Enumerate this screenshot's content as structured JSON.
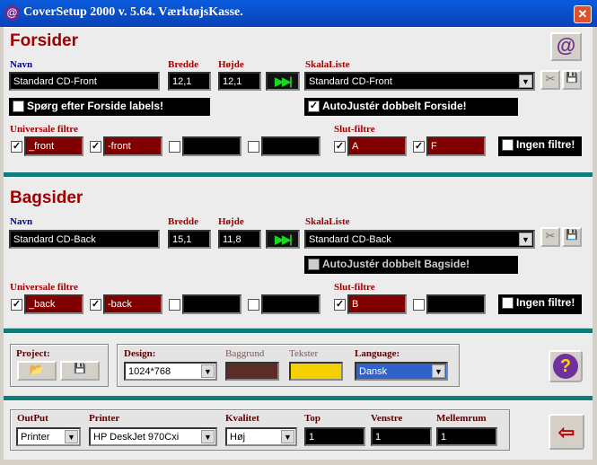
{
  "window": {
    "title": "CoverSetup 2000 v. 5.64. VærktøjsKasse.",
    "close_glyph": "✕",
    "app_glyph": "@"
  },
  "forsider": {
    "title": "Forsider",
    "navn_label": "Navn",
    "navn_value": "Standard CD-Front",
    "bredde_label": "Bredde",
    "bredde_value": "12,1",
    "hojde_label": "Højde",
    "hojde_value": "12,1",
    "skala_label": "SkalaListe",
    "skala_value": "Standard CD-Front",
    "spoerg_label": "Spørg efter Forside labels!",
    "autojuster_label": "AutoJustér dobbelt Forside!",
    "universale_label": "Universale filtre",
    "filters": [
      "_front",
      "-front",
      "",
      ""
    ],
    "filters_checked": [
      true,
      true,
      false,
      false
    ],
    "slut_label": "Slut-filtre",
    "slut_filters": [
      "A",
      "F"
    ],
    "slut_checked": [
      true,
      true
    ],
    "ingen_label": "Ingen filtre!"
  },
  "bagsider": {
    "title": "Bagsider",
    "navn_label": "Navn",
    "navn_value": "Standard CD-Back",
    "bredde_label": "Bredde",
    "bredde_value": "15,1",
    "hojde_label": "Højde",
    "hojde_value": "11,8",
    "skala_label": "SkalaListe",
    "skala_value": "Standard CD-Back",
    "autojuster_label": "AutoJustér dobbelt Bagside!",
    "universale_label": "Universale filtre",
    "filters": [
      "_back",
      "-back",
      "",
      ""
    ],
    "filters_checked": [
      true,
      true,
      false,
      false
    ],
    "slut_label": "Slut-filtre",
    "slut_filters": [
      "B",
      ""
    ],
    "slut_checked": [
      true,
      false
    ],
    "ingen_label": "Ingen filtre!"
  },
  "project": {
    "label": "Project:",
    "design_label": "Design:",
    "design_value": "1024*768",
    "baggrund_label": "Baggrund",
    "baggrund_color": "#5a2e24",
    "tekster_label": "Tekster",
    "tekster_color": "#f5d000",
    "language_label": "Language:",
    "language_value": "Dansk"
  },
  "output": {
    "output_label": "OutPut",
    "output_value": "Printer",
    "printer_label": "Printer",
    "printer_value": "HP DeskJet 970Cxi",
    "kvalitet_label": "Kvalitet",
    "kvalitet_value": "Høj",
    "top_label": "Top",
    "top_value": "1",
    "venstre_label": "Venstre",
    "venstre_value": "1",
    "mellemrum_label": "Mellemrum",
    "mellemrum_value": "1"
  },
  "icons": {
    "arrow": "▶▶|",
    "dropdown": "▼",
    "check": "✓",
    "help": "?",
    "scissors": "✂",
    "save": "💾",
    "folder": "📂",
    "exit": "⇦"
  }
}
